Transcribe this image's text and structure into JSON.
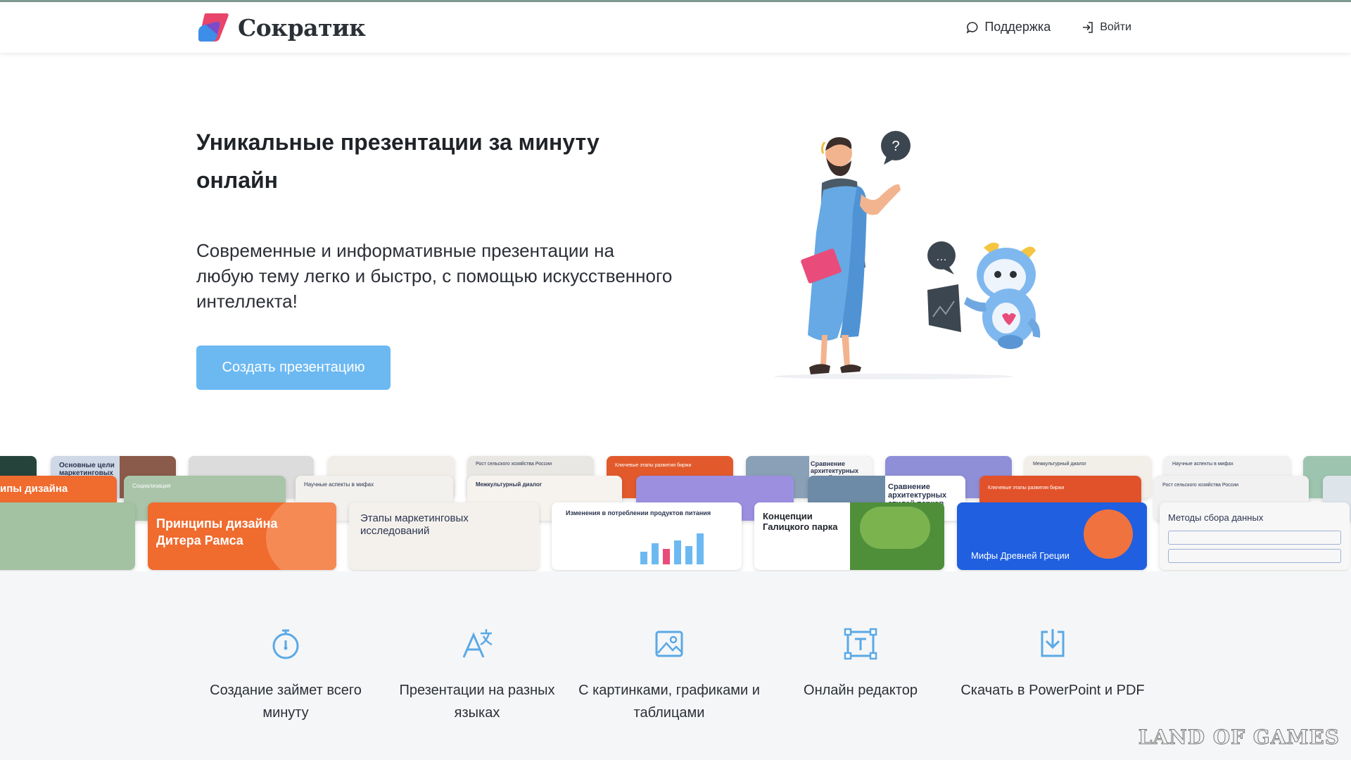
{
  "header": {
    "brand": "Сократик",
    "nav": [
      {
        "label": "Поддержка",
        "icon": "chat-bubble-icon"
      },
      {
        "label": "Войти",
        "icon": "login-arrow-icon"
      }
    ]
  },
  "hero": {
    "title": "Уникальные презентации за минуту онлайн",
    "subtitle": "Современные и информативные презентации на любую тему легко и быстро, с помощью искусственного интеллекта!",
    "cta_label": "Создать презентацию"
  },
  "illustration": {
    "question_mark": "?",
    "ellipsis": "…"
  },
  "slides": {
    "back": [
      "Основные цели маркетинговых",
      "Социализация",
      "Научные аспекты в мифах",
      "Рост сельского хозяйства России",
      "Ключевые этапы развития биржи",
      "Сравнение архитектурных стилей",
      "Межкультурный диалог",
      "Научные аспекты в мифах"
    ],
    "front": [
      "ипы дизайна",
      "Принципы дизайна Дитера Рамса",
      "Этапы маркетинговых исследований",
      "Межкультурный диалог",
      "Изменения в потреблении продуктов питания",
      "Концепции Галицкого парка",
      "Сравнение архитектурных стилей парков",
      "Ключевые этапы развития биржи",
      "Мифы Древней Греции",
      "Рост сельского хозяйства России",
      "Методы сбора данных"
    ]
  },
  "features": [
    {
      "label": "Создание займет всего минуту",
      "icon": "stopwatch-icon"
    },
    {
      "label": "Презентации на разных языках",
      "icon": "translate-icon"
    },
    {
      "label": "С картинками, графиками и таблицами",
      "icon": "image-icon"
    },
    {
      "label": "Онлайн редактор",
      "icon": "text-editor-icon"
    },
    {
      "label": "Скачать в PowerPoint и PDF",
      "icon": "download-icon"
    }
  ],
  "watermark": "LAND OF GAMES",
  "colors": {
    "accent": "#6cb9f2",
    "icon_blue": "#5aa9e6",
    "feature_bg": "#f5f6f8"
  }
}
